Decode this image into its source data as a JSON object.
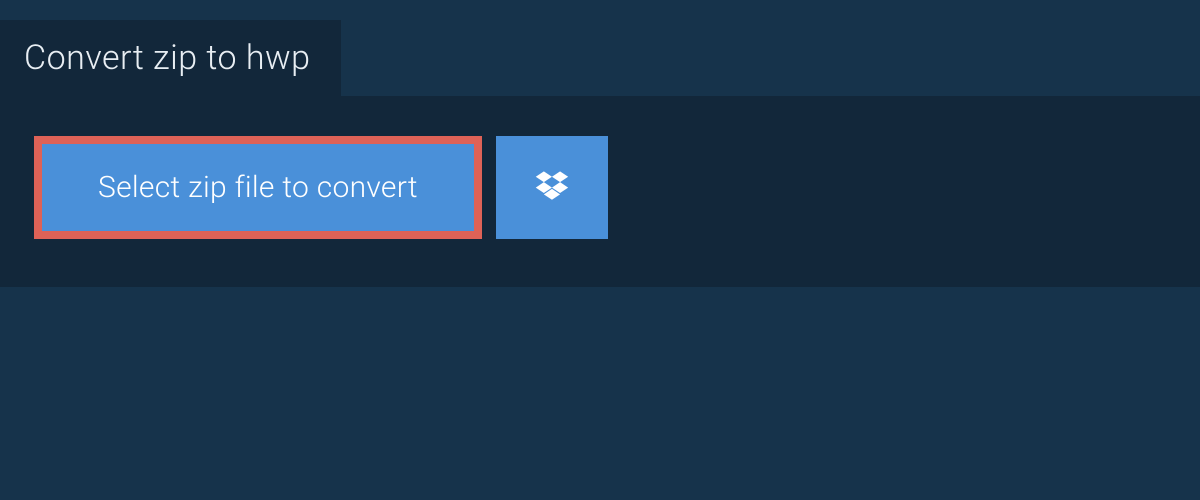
{
  "tab": {
    "title": "Convert zip to hwp"
  },
  "actions": {
    "select_label": "Select zip file to convert"
  },
  "colors": {
    "page_bg": "#16334b",
    "panel_bg": "#12273a",
    "button_bg": "#4a90d9",
    "highlight_border": "#de6257",
    "text_light": "#e8eef3"
  }
}
